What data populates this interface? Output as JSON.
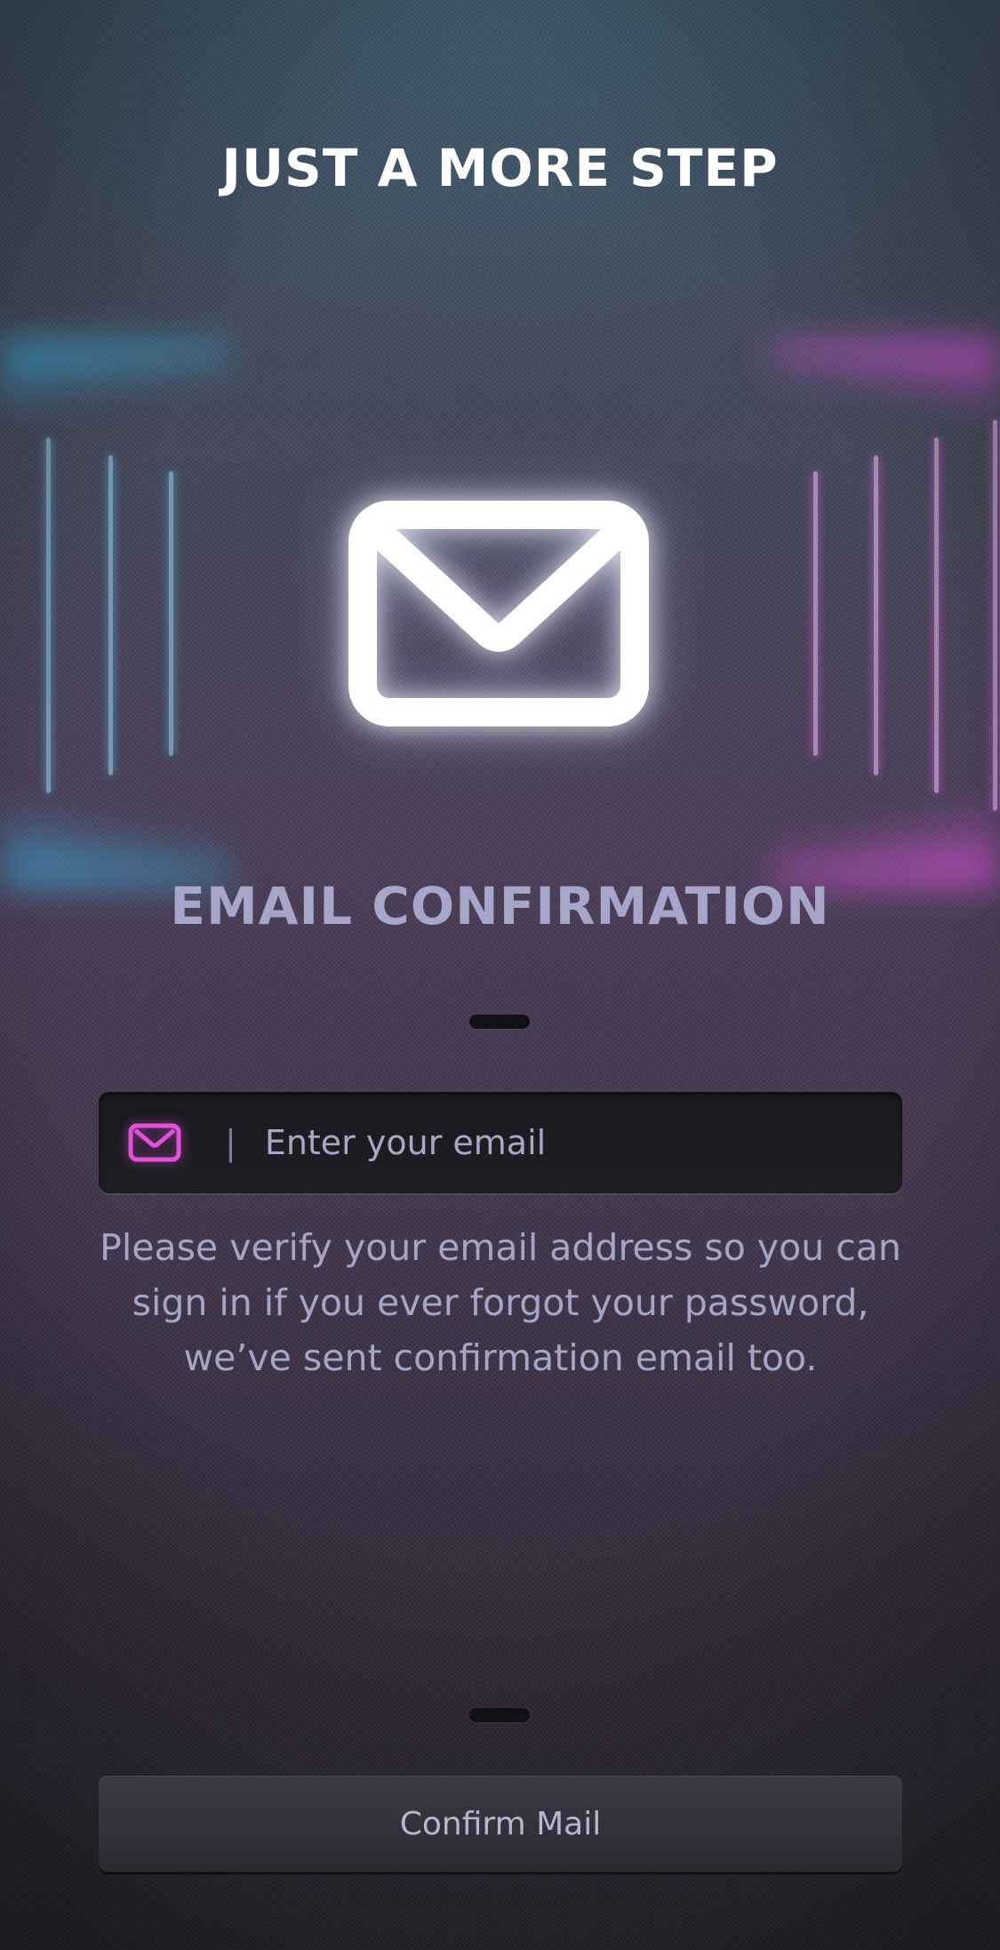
{
  "header": {
    "title": "JUST A MORE STEP"
  },
  "hero": {
    "icon": "envelope-icon"
  },
  "section": {
    "title": "EMAIL CONFIRMATION"
  },
  "email_input": {
    "icon": "envelope-icon",
    "icon_color": "#e052d6",
    "divider": "|",
    "value": "",
    "placeholder": "Enter your email"
  },
  "help": {
    "lines": [
      "Please verify your email address so you can",
      "sign in if you ever forgot your password,",
      "we’ve sent confirmation email too."
    ]
  },
  "actions": {
    "confirm_label": "Confirm Mail"
  },
  "colors": {
    "title": "#ffffff",
    "section_title": "#a7a6c9",
    "text": "#a6a5c6",
    "neon_left": "#3caadc",
    "neon_right": "#d750dc"
  }
}
